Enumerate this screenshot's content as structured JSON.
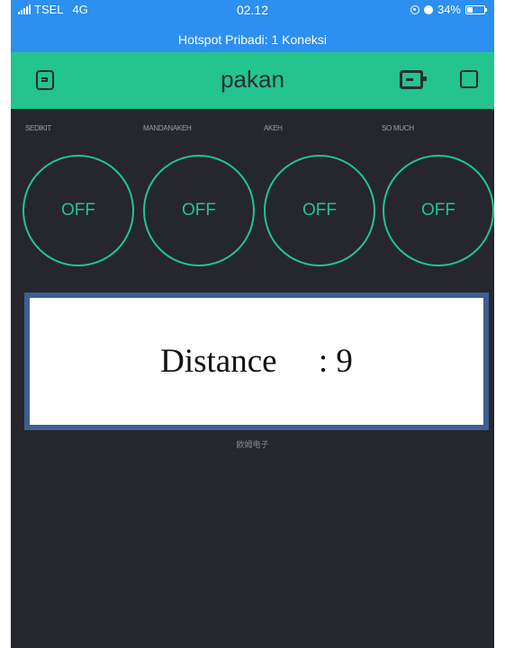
{
  "status_bar": {
    "carrier": "TSEL",
    "network": "4G",
    "time": "02.12",
    "battery_percent": "34%",
    "battery_level": 0.34,
    "hotspot": "Hotspot Pribadi: 1 Koneksi"
  },
  "header": {
    "title": "pakan",
    "bg_color": "#23c48e"
  },
  "labels": [
    "SEDIKIT",
    "MANDANAKEH",
    "AKEH",
    "SO MUCH"
  ],
  "buttons": [
    "OFF",
    "OFF",
    "OFF",
    "OFF"
  ],
  "display": {
    "text": "Distance     : 9",
    "border_color": "#3d5f92"
  },
  "caption": "欧姆电子",
  "icons": [
    "exit-icon",
    "device-icon",
    "square-icon"
  ],
  "colors": {
    "accent": "#23c48e",
    "background": "#25272c",
    "statusbar": "#2d8ff0"
  }
}
